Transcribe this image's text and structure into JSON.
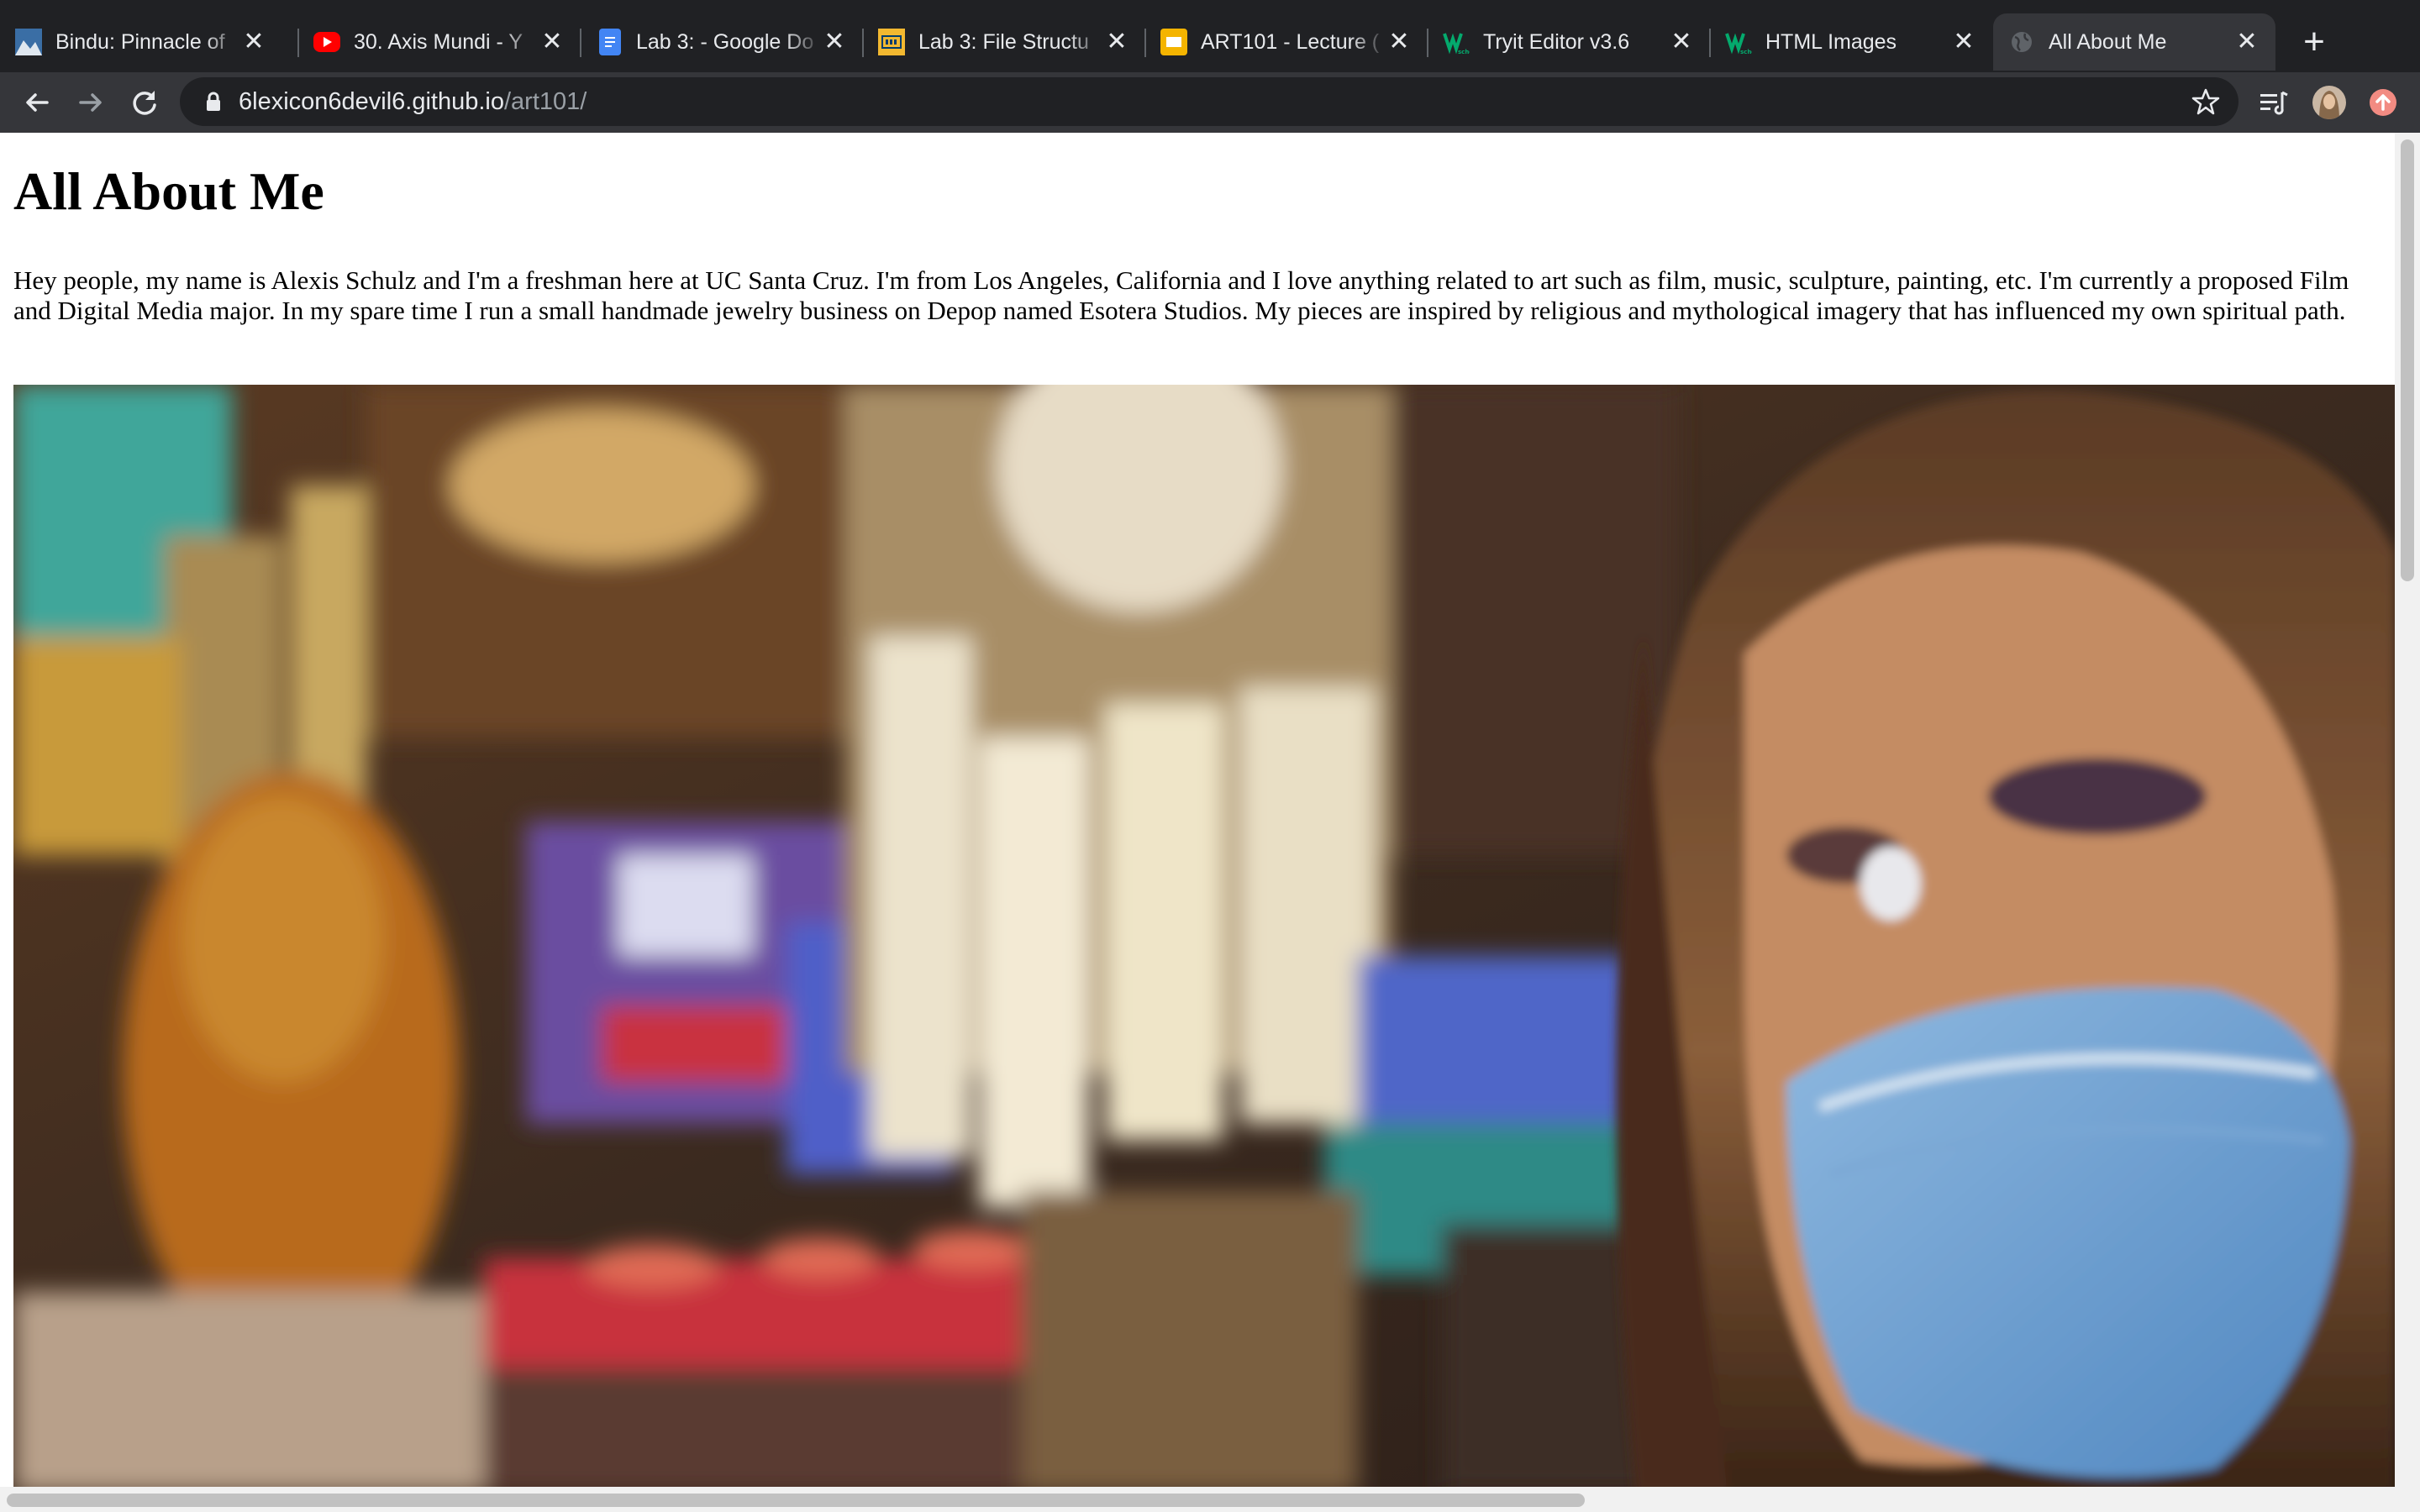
{
  "browser": {
    "tabs": [
      {
        "title": "Bindu: Pinnacle of",
        "icon": "image-favicon-icon",
        "active": false
      },
      {
        "title": "30. Axis Mundi - Y",
        "icon": "youtube-favicon-icon",
        "active": false
      },
      {
        "title": "Lab 3: - Google Do",
        "icon": "google-docs-favicon-icon",
        "active": false
      },
      {
        "title": "Lab 3: File Structu",
        "icon": "ucsc-favicon-icon",
        "active": false
      },
      {
        "title": "ART101 - Lecture (",
        "icon": "google-slides-favicon-icon",
        "active": false
      },
      {
        "title": "Tryit Editor v3.6",
        "icon": "w3schools-favicon-icon",
        "active": false
      },
      {
        "title": "HTML Images",
        "icon": "w3schools-favicon-icon",
        "active": false
      },
      {
        "title": "All About Me",
        "icon": "globe-favicon-icon",
        "active": true
      }
    ],
    "address": {
      "host": "6lexicon6devil6.github.io",
      "path": "/art101/"
    },
    "colors": {
      "tabstrip": "#202124",
      "toolbar": "#35363a",
      "text": "#e8eaed"
    }
  },
  "page": {
    "heading": "All About Me",
    "bio": "Hey people, my name is Alexis Schulz and I'm a freshman here at UC Santa Cruz. I'm from Los Angeles, California and I love anything related to art such as film, music, sculpture, painting, etc. I'm currently a proposed Film and Digital Media major. In my spare time I run a small handmade jewelry business on Depop named Esotera Studios. My pieces are inspired by religious and mythological imagery that has influenced my own spiritual path.",
    "photo": {
      "subject": "photo-selfie-in-shop"
    }
  }
}
